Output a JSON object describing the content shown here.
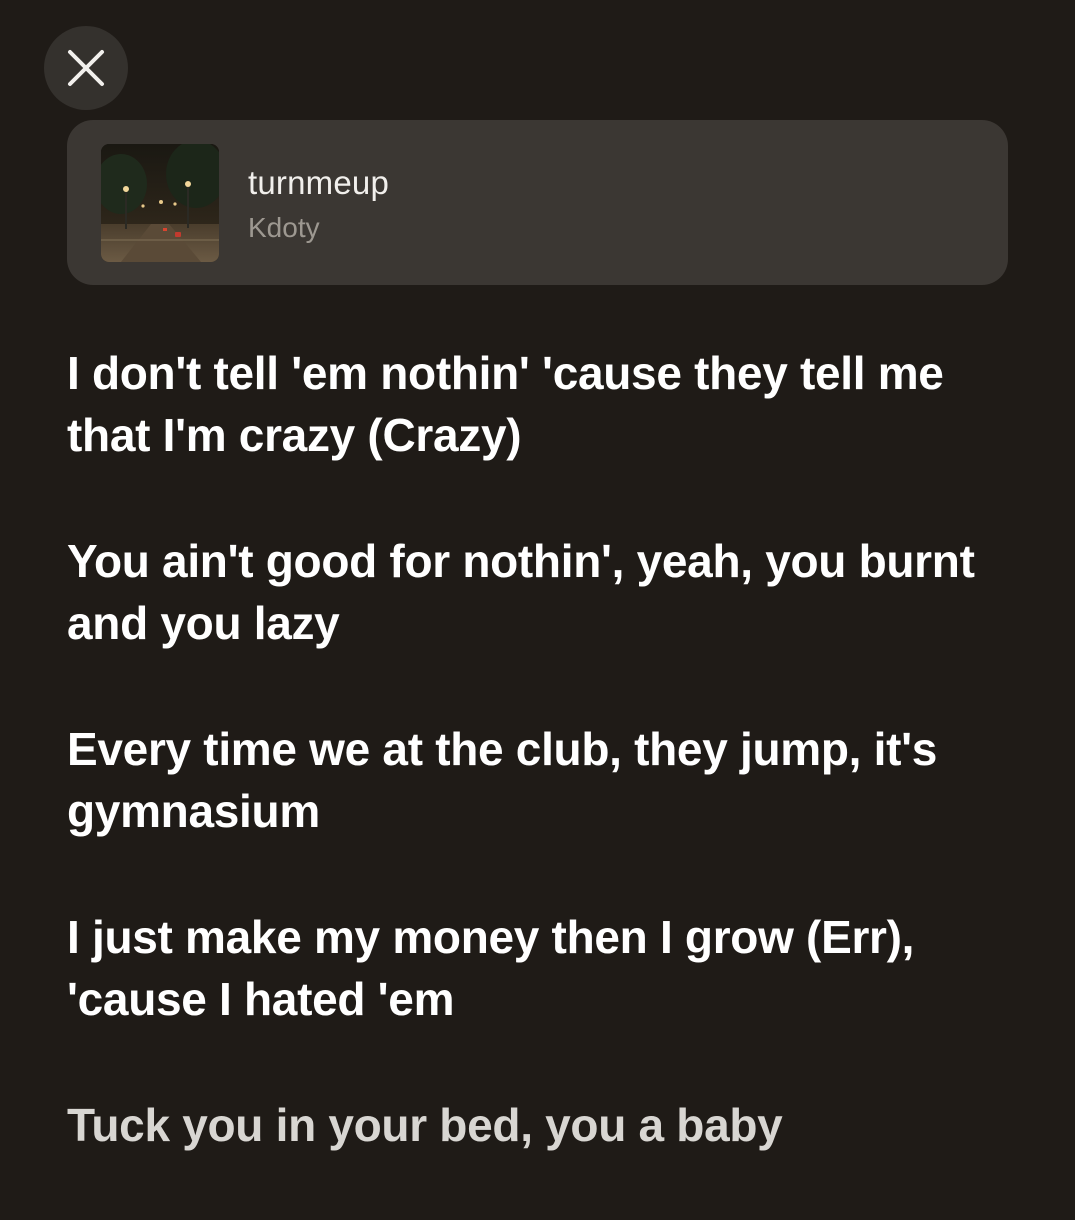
{
  "close_button": {
    "icon": "close-icon"
  },
  "track": {
    "title": "turnmeup",
    "artist": "Kdoty",
    "artwork_icon": "album-artwork-night-street"
  },
  "lyrics": [
    "I don't tell 'em nothin' 'cause they tell me that I'm crazy (Crazy)",
    "You ain't good for nothin', yeah, you burnt and you lazy",
    "Every time we at the club, they jump, it's gymnasium",
    "I just make my money then I grow (Err), 'cause I hated 'em",
    "Tuck you in your bed, you a baby"
  ],
  "colors": {
    "background": "#1f1b17",
    "card": "#3b3733",
    "lyric_text": "#ffffff",
    "artist_text": "#9d9891"
  }
}
